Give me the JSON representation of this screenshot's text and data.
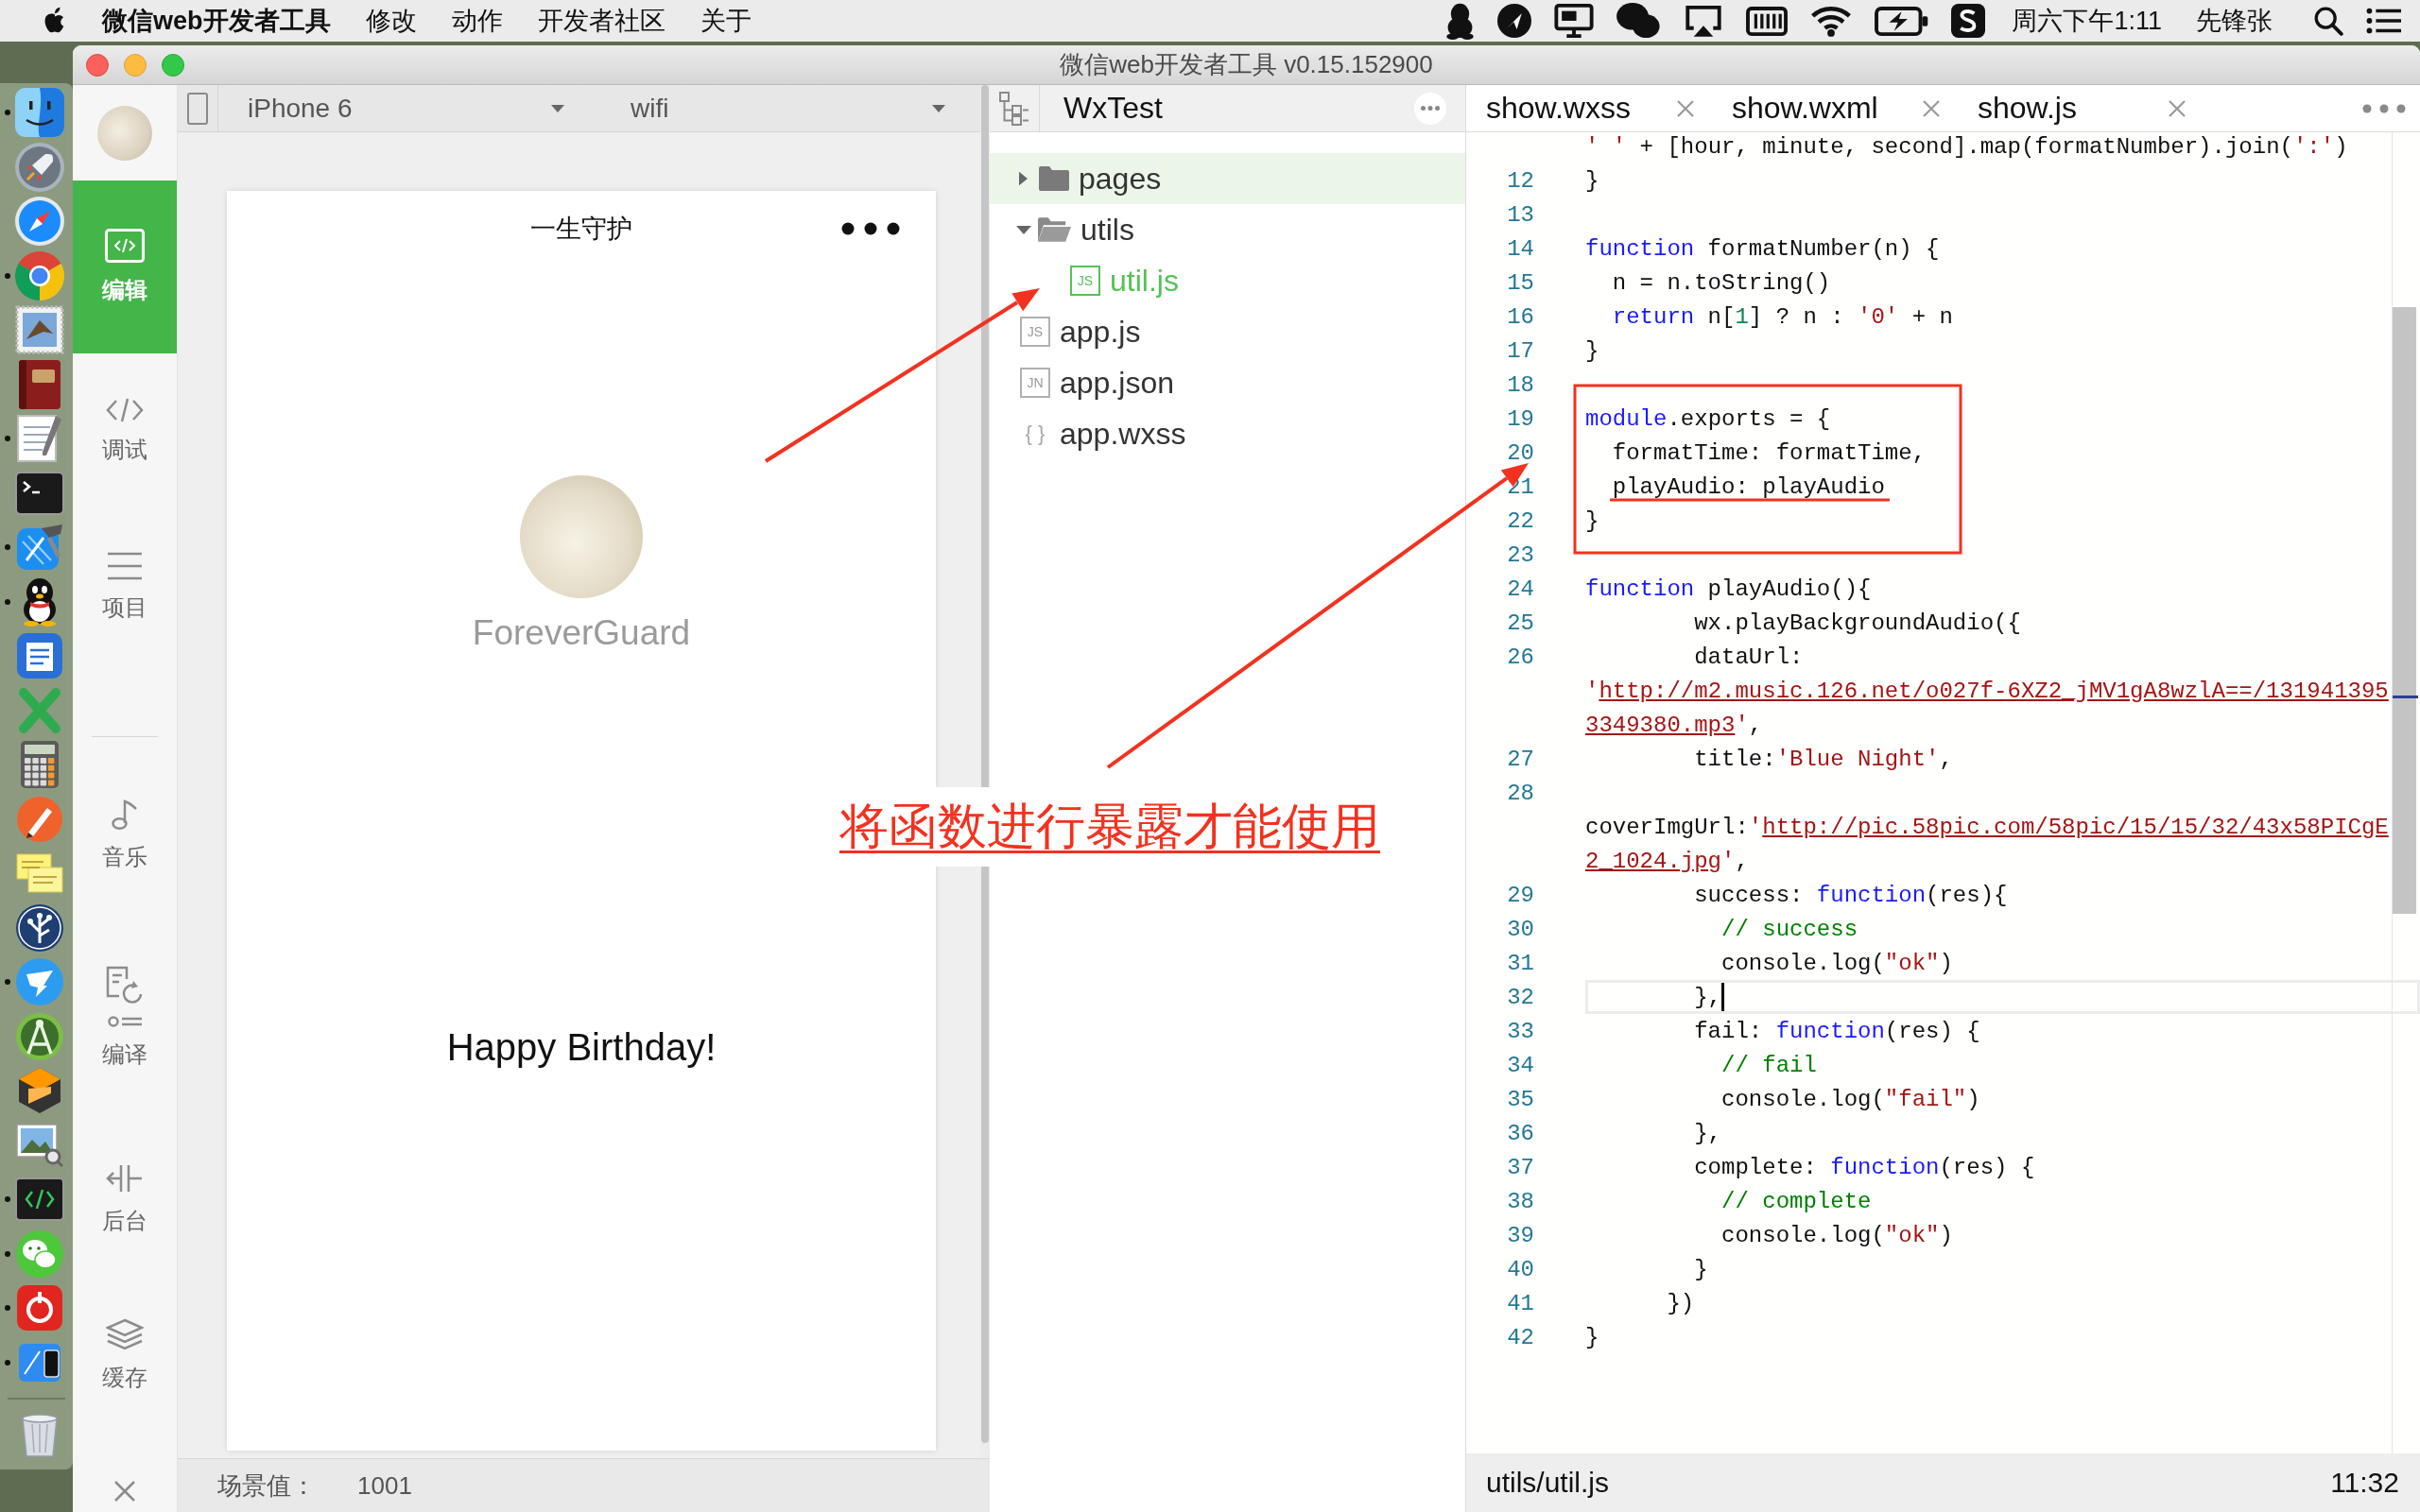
{
  "menu_bar": {
    "app_name": "微信web开发者工具",
    "menus": [
      "修改",
      "动作",
      "开发者社区",
      "关于"
    ],
    "clock": "周六下午1:11",
    "user": "先锋张"
  },
  "dock": [
    {
      "kind": "finder",
      "running": true
    },
    {
      "kind": "rocket",
      "running": false
    },
    {
      "kind": "compass",
      "running": false
    },
    {
      "kind": "chrome",
      "running": true
    },
    {
      "kind": "stamp",
      "running": false
    },
    {
      "kind": "book",
      "running": false
    },
    {
      "kind": "notepad",
      "running": true
    },
    {
      "kind": "terminal",
      "running": false
    },
    {
      "kind": "hammer",
      "running": true
    },
    {
      "kind": "penguin",
      "running": true
    },
    {
      "kind": "document",
      "running": false
    },
    {
      "kind": "cross",
      "running": false
    },
    {
      "kind": "calculator",
      "running": false
    },
    {
      "kind": "pen",
      "running": false
    },
    {
      "kind": "notes",
      "running": false
    },
    {
      "kind": "tree",
      "running": false
    },
    {
      "kind": "wing",
      "running": true
    },
    {
      "kind": "dividers",
      "running": false
    },
    {
      "kind": "cube",
      "running": false
    },
    {
      "kind": "picture",
      "running": false
    },
    {
      "kind": "code",
      "running": true
    },
    {
      "kind": "chat",
      "running": true
    },
    {
      "kind": "swirl",
      "running": true
    },
    {
      "kind": "phone",
      "running": true
    }
  ],
  "window": {
    "title": "微信web开发者工具 v0.15.152900"
  },
  "tool_groups": [
    {
      "items": [
        {
          "kind": "edit",
          "label": "编辑",
          "selected": true
        },
        {
          "kind": "debug",
          "label": "调试",
          "selected": false
        },
        {
          "kind": "project",
          "label": "项目",
          "selected": false
        }
      ]
    },
    {
      "items": [
        {
          "kind": "music",
          "label": "音乐",
          "selected": false
        },
        {
          "kind": "compile",
          "label": "编译",
          "selected": false
        },
        {
          "kind": "background",
          "label": "后台",
          "selected": false
        },
        {
          "kind": "cache",
          "label": "缓存",
          "selected": false
        }
      ]
    }
  ],
  "simulator": {
    "device": "iPhone 6",
    "network": "wifi",
    "nav_title": "一生守护",
    "name": "ForeverGuard",
    "message": "Happy Birthday!",
    "scene_label": "场景值：",
    "scene_value": "1001"
  },
  "project": {
    "name": "WxTest",
    "tree": [
      {
        "kind": "folder",
        "name": "pages",
        "expanded": false,
        "selected": true,
        "active": false
      },
      {
        "kind": "folder",
        "name": "utils",
        "expanded": true,
        "selected": false,
        "active": false,
        "children": [
          {
            "kind": "file",
            "badge": "JS",
            "name": "util.js",
            "selected": false,
            "active": true
          }
        ]
      },
      {
        "kind": "file",
        "badge": "JS",
        "name": "app.js",
        "selected": false,
        "active": false
      },
      {
        "kind": "file",
        "badge": "JN",
        "name": "app.json",
        "selected": false,
        "active": false
      },
      {
        "kind": "style",
        "badge": "{ }",
        "name": "app.wxss",
        "selected": false,
        "active": false
      }
    ]
  },
  "editor": {
    "tabs": [
      {
        "label": "show.wxss"
      },
      {
        "label": "show.wxml"
      },
      {
        "label": "show.js"
      }
    ],
    "rows": [
      {
        "current": false,
        "tokens": [
          {
            "kind": "string",
            "text": "' '"
          },
          {
            "kind": "plain",
            "text": " + [hour, minute, second].map(formatNumber).join("
          },
          {
            "kind": "string",
            "text": "':'"
          },
          {
            "kind": "plain",
            "text": ")"
          }
        ]
      },
      {
        "number": "12",
        "current": false,
        "tokens": [
          {
            "kind": "plain",
            "text": "}"
          }
        ]
      },
      {
        "number": "13",
        "current": false
      },
      {
        "number": "14",
        "current": false,
        "tokens": [
          {
            "kind": "keyword",
            "text": "function"
          },
          {
            "kind": "plain",
            "text": " formatNumber(n) {"
          }
        ]
      },
      {
        "number": "15",
        "current": false,
        "tokens": [
          {
            "kind": "plain",
            "text": "  n = n.toString()"
          }
        ]
      },
      {
        "number": "16",
        "current": false,
        "tokens": [
          {
            "kind": "keyword",
            "text": "  return"
          },
          {
            "kind": "plain",
            "text": " n["
          },
          {
            "kind": "number",
            "text": "1"
          },
          {
            "kind": "plain",
            "text": "] ? n : "
          },
          {
            "kind": "string",
            "text": "'0'"
          },
          {
            "kind": "plain",
            "text": " + n"
          }
        ]
      },
      {
        "number": "17",
        "current": false,
        "tokens": [
          {
            "kind": "plain",
            "text": "}"
          }
        ]
      },
      {
        "number": "18",
        "current": false
      },
      {
        "number": "19",
        "current": false,
        "tokens": [
          {
            "kind": "keyword",
            "text": "module"
          },
          {
            "kind": "plain",
            "text": ".exports = {"
          }
        ]
      },
      {
        "number": "20",
        "current": false,
        "tokens": [
          {
            "kind": "plain",
            "text": "  formatTime: formatTime,"
          }
        ]
      },
      {
        "number": "21",
        "current": false,
        "tokens": [
          {
            "kind": "plain",
            "text": "  playAudio: playAudio"
          }
        ]
      },
      {
        "number": "22",
        "current": false,
        "tokens": [
          {
            "kind": "plain",
            "text": "}"
          }
        ]
      },
      {
        "number": "23",
        "current": false
      },
      {
        "number": "24",
        "current": false,
        "tokens": [
          {
            "kind": "keyword",
            "text": "function"
          },
          {
            "kind": "plain",
            "text": " playAudio(){"
          }
        ]
      },
      {
        "number": "25",
        "current": false,
        "tokens": [
          {
            "kind": "plain",
            "text": "        wx.playBackgroundAudio({"
          }
        ]
      },
      {
        "number": "26",
        "current": false,
        "tokens": [
          {
            "kind": "plain",
            "text": "        dataUrl:"
          }
        ]
      },
      {
        "current": false,
        "tokens": [
          {
            "kind": "string",
            "text": "'"
          },
          {
            "kind": "link",
            "text": "http://m2.music.126.net/o027f-6XZ2_jMV1gA8wzlA==/131941395"
          }
        ]
      },
      {
        "current": false,
        "tokens": [
          {
            "kind": "link",
            "text": "3349380.mp3"
          },
          {
            "kind": "string",
            "text": "'"
          },
          {
            "kind": "plain",
            "text": ","
          }
        ]
      },
      {
        "number": "27",
        "current": false,
        "tokens": [
          {
            "kind": "plain",
            "text": "        title:"
          },
          {
            "kind": "string",
            "text": "'Blue Night'"
          },
          {
            "kind": "plain",
            "text": ","
          }
        ]
      },
      {
        "number": "28",
        "current": false
      },
      {
        "current": false,
        "tokens": [
          {
            "kind": "plain",
            "text": "coverImgUrl:"
          },
          {
            "kind": "string",
            "text": "'"
          },
          {
            "kind": "link",
            "text": "http://pic.58pic.com/58pic/15/15/32/43x58PICgE"
          }
        ]
      },
      {
        "current": false,
        "tokens": [
          {
            "kind": "link",
            "text": "2_1024.jpg"
          },
          {
            "kind": "string",
            "text": "'"
          },
          {
            "kind": "plain",
            "text": ","
          }
        ]
      },
      {
        "number": "29",
        "current": false,
        "tokens": [
          {
            "kind": "plain",
            "text": "        success: "
          },
          {
            "kind": "keyword",
            "text": "function"
          },
          {
            "kind": "plain",
            "text": "(res){"
          }
        ]
      },
      {
        "number": "30",
        "current": false,
        "tokens": [
          {
            "kind": "comment",
            "text": "          // success"
          }
        ]
      },
      {
        "number": "31",
        "current": false,
        "tokens": [
          {
            "kind": "plain",
            "text": "          console.log("
          },
          {
            "kind": "string",
            "text": "\"ok\""
          },
          {
            "kind": "plain",
            "text": ")"
          }
        ]
      },
      {
        "number": "32",
        "current": true,
        "tokens": [
          {
            "kind": "plain",
            "text": "        },"
          }
        ]
      },
      {
        "number": "33",
        "current": false,
        "tokens": [
          {
            "kind": "plain",
            "text": "        fail: "
          },
          {
            "kind": "keyword",
            "text": "function"
          },
          {
            "kind": "plain",
            "text": "(res) {"
          }
        ]
      },
      {
        "number": "34",
        "current": false,
        "tokens": [
          {
            "kind": "comment",
            "text": "          // fail"
          }
        ]
      },
      {
        "number": "35",
        "current": false,
        "tokens": [
          {
            "kind": "plain",
            "text": "          console.log("
          },
          {
            "kind": "string",
            "text": "\"fail\""
          },
          {
            "kind": "plain",
            "text": ")"
          }
        ]
      },
      {
        "number": "36",
        "current": false,
        "tokens": [
          {
            "kind": "plain",
            "text": "        },"
          }
        ]
      },
      {
        "number": "37",
        "current": false,
        "tokens": [
          {
            "kind": "plain",
            "text": "        complete: "
          },
          {
            "kind": "keyword",
            "text": "function"
          },
          {
            "kind": "plain",
            "text": "(res) {"
          }
        ]
      },
      {
        "number": "38",
        "current": false,
        "tokens": [
          {
            "kind": "comment",
            "text": "          // complete"
          }
        ]
      },
      {
        "number": "39",
        "current": false,
        "tokens": [
          {
            "kind": "plain",
            "text": "          console.log("
          },
          {
            "kind": "string",
            "text": "\"ok\""
          },
          {
            "kind": "plain",
            "text": ")"
          }
        ]
      },
      {
        "number": "40",
        "current": false,
        "tokens": [
          {
            "kind": "plain",
            "text": "        }"
          }
        ]
      },
      {
        "number": "41",
        "current": false,
        "tokens": [
          {
            "kind": "plain",
            "text": "      })"
          }
        ]
      },
      {
        "number": "42",
        "current": false,
        "tokens": [
          {
            "kind": "plain",
            "text": "}"
          }
        ]
      }
    ],
    "status_path": "utils/util.js",
    "cursor_position": "11:32"
  },
  "annotation": {
    "text": "将函数进行暴露才能使用"
  }
}
